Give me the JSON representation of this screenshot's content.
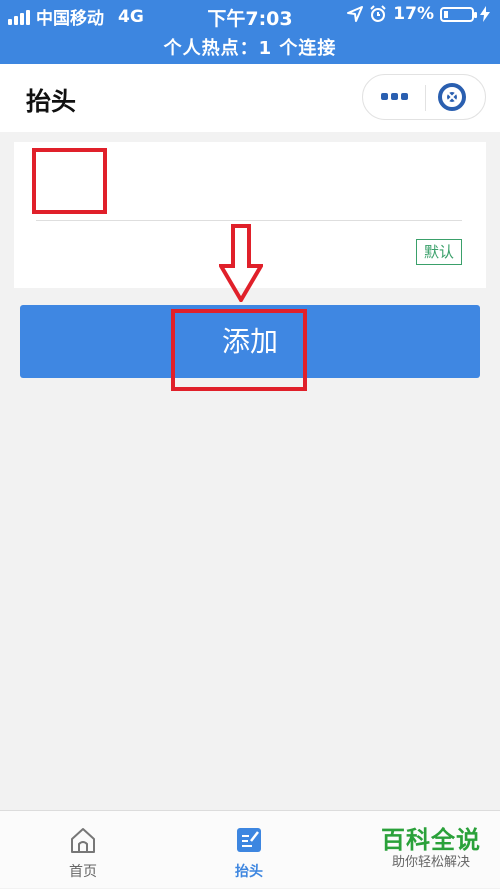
{
  "status_bar": {
    "carrier": "中国移动",
    "network": "4G",
    "time": "下午7:03",
    "battery_percent": "17%",
    "battery_level": 0.17,
    "hotspot_text": "个人热点：1 个连接"
  },
  "nav": {
    "title": "抬头",
    "more_icon": "more-dots-icon",
    "close_icon": "close-target-icon"
  },
  "form": {
    "title_input_value": "",
    "default_badge": "默认"
  },
  "add_button_label": "添加",
  "tabs": [
    {
      "label": "首页",
      "icon": "home-icon",
      "active": false
    },
    {
      "label": "抬头",
      "icon": "edit-list-icon",
      "active": true
    }
  ],
  "watermark": {
    "main": "百科全说",
    "sub": "助你轻松解决"
  },
  "colors": {
    "primary": "#3d86e0",
    "annotation": "#e0202a",
    "default_badge": "#3aa06a",
    "watermark": "#2aa13a"
  }
}
